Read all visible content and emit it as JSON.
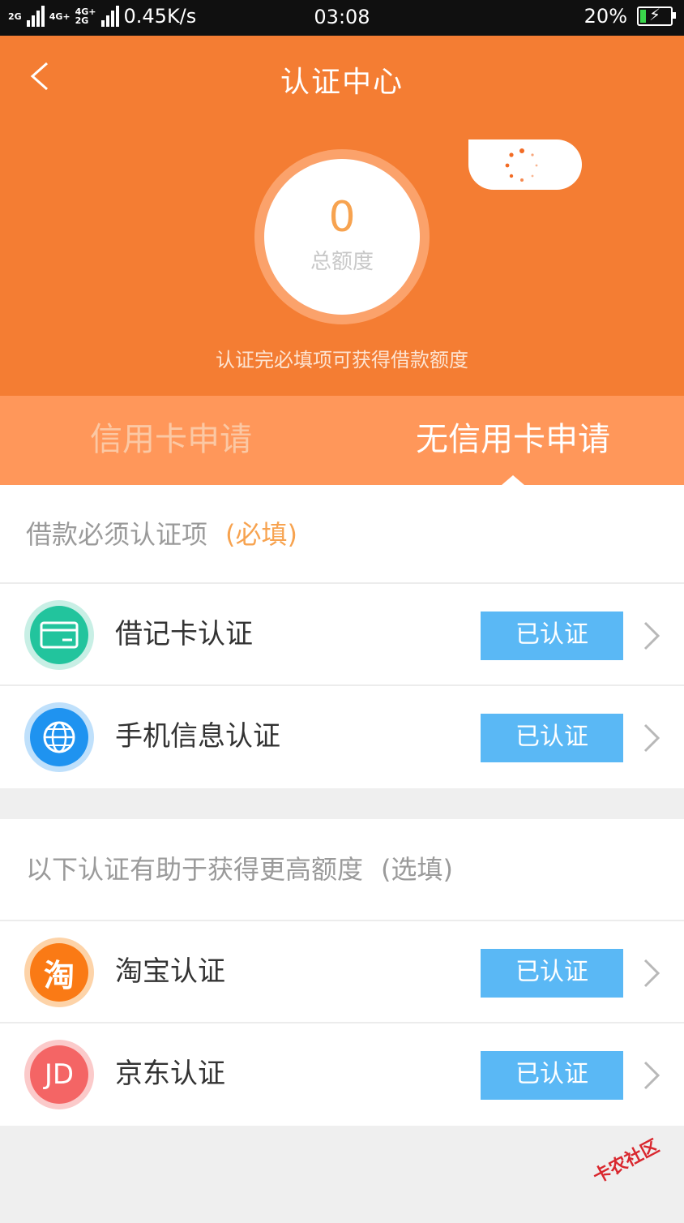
{
  "status_bar": {
    "network_text": "0.45K/s",
    "net_tags": [
      "2G",
      "4G+",
      "4G+",
      "2G"
    ],
    "time": "03:08",
    "battery_text": "20%",
    "battery_level": 0.2,
    "battery_color": "#3ad54b"
  },
  "header": {
    "title": "认证中心",
    "back_icon": "chevron-left-icon",
    "amount_value": "0",
    "amount_label": "总额度",
    "hint": "认证完必填项可获得借款额度",
    "accent": "#f47d33"
  },
  "tabs": [
    {
      "label": "信用卡申请",
      "active": false
    },
    {
      "label": "无信用卡申请",
      "active": true
    }
  ],
  "required_section": {
    "title": "借款必须认证项",
    "tag": "(必填)",
    "items": [
      {
        "label": "借记卡认证",
        "status": "已认证",
        "icon": "bank-card-icon",
        "color": "#22c49d"
      },
      {
        "label": "手机信息认证",
        "status": "已认证",
        "icon": "globe-icon",
        "color": "#1f93f0"
      }
    ]
  },
  "optional_section": {
    "title": "以下认证有助于获得更高额度",
    "tag": "(选填)",
    "items": [
      {
        "label": "淘宝认证",
        "status": "已认证",
        "icon": "taobao-icon",
        "glyph": "淘",
        "color": "#fa7a15"
      },
      {
        "label": "京东认证",
        "status": "已认证",
        "icon": "jd-icon",
        "glyph": "JD",
        "color": "#f46565"
      }
    ]
  },
  "status_color": "#5ab8f5",
  "watermark": "卡农社区"
}
